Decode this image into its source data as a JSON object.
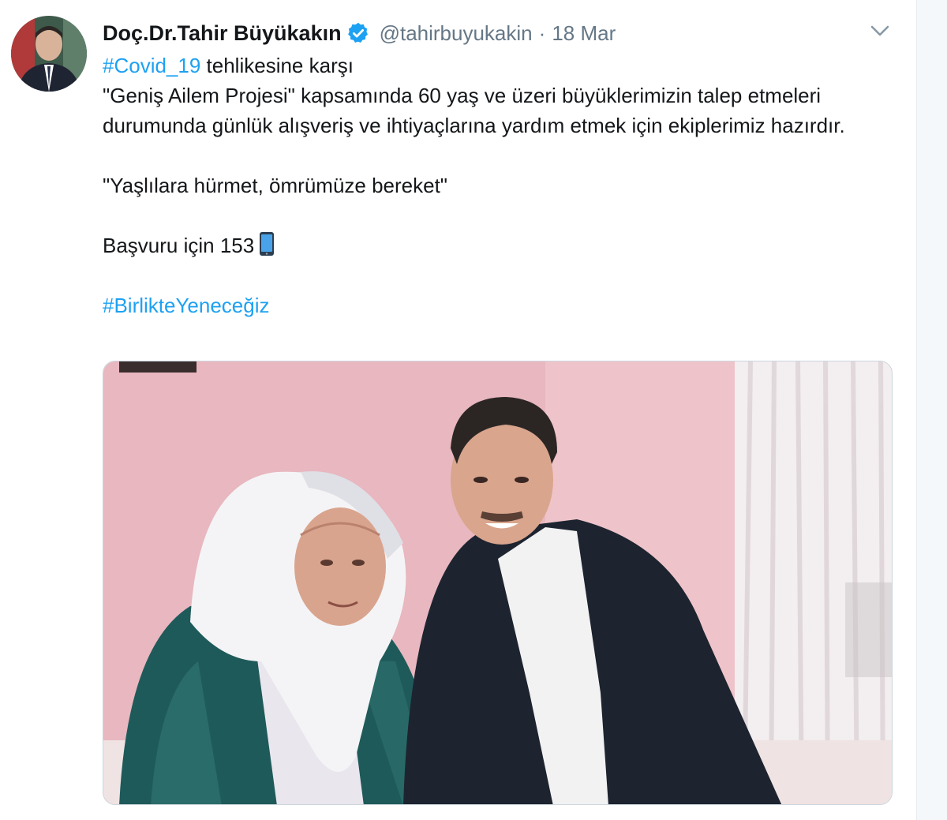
{
  "author": {
    "display_name": "Doç.Dr.Tahir Büyükakın",
    "handle": "@tahirbuyukakin",
    "separator": "·",
    "date": "18 Mar"
  },
  "tweet": {
    "line1_hashtag": "#Covid_19",
    "line1_text": " tehlikesine karşı",
    "paragraph1": "\"Geniş Ailem Projesi\" kapsamında 60 yaş ve üzeri büyüklerimizin talep etmeleri durumunda günlük alışveriş ve ihtiyaçlarına yardım etmek için ekiplerimiz hazırdır.",
    "quote": "\"Yaşlılara hürmet, ömrümüze bereket\"",
    "apply_text": "Başvuru için 153",
    "hashtag2": "#BirlikteYeneceğiz"
  },
  "icons": {
    "verified": "verified-badge-icon",
    "phone": "mobile-phone-emoji",
    "caret": "chevron-down-icon"
  },
  "colors": {
    "link": "#1da1f2",
    "text": "#14171a",
    "muted": "#657786",
    "wall": "#e9b9c1"
  }
}
